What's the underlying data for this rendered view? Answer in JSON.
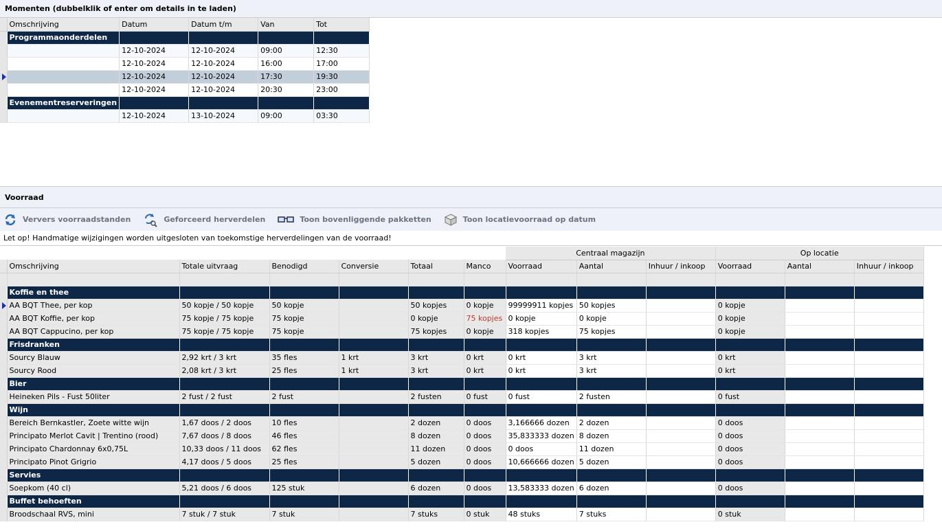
{
  "momenten": {
    "title": "Momenten (dubbelklik of enter om details in te laden)",
    "columns": [
      "Omschrijving",
      "Datum",
      "Datum t/m",
      "Van",
      "Tot"
    ],
    "groups": [
      {
        "name": "Programmaonderdelen",
        "rows": [
          {
            "omschrijving": "",
            "datum": "12-10-2024",
            "datum_tm": "12-10-2024",
            "van": "09:00",
            "tot": "12:30"
          },
          {
            "omschrijving": "",
            "datum": "12-10-2024",
            "datum_tm": "12-10-2024",
            "van": "16:00",
            "tot": "17:00"
          },
          {
            "omschrijving": "",
            "datum": "12-10-2024",
            "datum_tm": "12-10-2024",
            "van": "17:30",
            "tot": "19:30",
            "selected": true
          },
          {
            "omschrijving": "",
            "datum": "12-10-2024",
            "datum_tm": "12-10-2024",
            "van": "20:30",
            "tot": "23:00"
          }
        ]
      },
      {
        "name": "Evenementreserveringen",
        "rows": [
          {
            "omschrijving": "",
            "datum": "12-10-2024",
            "datum_tm": "13-10-2024",
            "van": "09:00",
            "tot": "03:30"
          }
        ]
      }
    ]
  },
  "voorraad": {
    "title": "Voorraad",
    "toolbar": {
      "refresh_label": "Ververs voorraadstanden",
      "force_label": "Geforceerd herverdelen",
      "packages_label": "Toon bovenliggende pakketten",
      "location_label": "Toon locatievoorraad op datum"
    },
    "warning": "Let op! Handmatige wijzigingen worden uitgesloten van toekomstige herverdelingen van de voorraad!",
    "supergroups": {
      "central": "Centraal magazijn",
      "location": "Op locatie"
    },
    "columns": [
      "Omschrijving",
      "Totale uitvraag",
      "Benodigd",
      "Conversie",
      "Totaal",
      "Manco",
      "Voorraad",
      "Aantal",
      "Inhuur / inkoop",
      "Voorraad",
      "Aantal",
      "Inhuur / inkoop"
    ],
    "groups": [
      {
        "name": "Koffie en thee",
        "rows": [
          [
            "AA BQT Thee, per kop",
            "50 kopje / 50 kopje",
            "50 kopje",
            "",
            "50 kopjes",
            "0 kopje",
            "99999911 kopjes",
            "50 kopjes",
            "",
            "0 kopje",
            "",
            ""
          ],
          [
            "AA BQT Koffie, per kop",
            "75 kopje / 75 kopje",
            "75 kopje",
            "",
            "0 kopje",
            "75 kopjes",
            "0 kopje",
            "0 kopje",
            "",
            "0 kopje",
            "",
            ""
          ],
          [
            "AA BQT Cappucino, per kop",
            "75 kopje / 75 kopje",
            "75 kopje",
            "",
            "75 kopjes",
            "0 kopje",
            "318 kopjes",
            "75 kopjes",
            "",
            "0 kopje",
            "",
            ""
          ]
        ]
      },
      {
        "name": "Frisdranken",
        "rows": [
          [
            "Sourcy Blauw",
            "2,92 krt / 3 krt",
            "35 fles",
            "1 krt",
            "3 krt",
            "0 krt",
            "0 krt",
            "3 krt",
            "",
            "0 krt",
            "",
            ""
          ],
          [
            "Sourcy Rood",
            "2,08 krt / 3 krt",
            "25 fles",
            "1 krt",
            "3 krt",
            "0 krt",
            "0 krt",
            "3 krt",
            "",
            "0 krt",
            "",
            ""
          ]
        ]
      },
      {
        "name": "Bier",
        "rows": [
          [
            "Heineken Pils - Fust 50liter",
            "2 fust / 2 fust",
            "2 fust",
            "",
            "2 fusten",
            "0 fust",
            "0 fust",
            "2 fusten",
            "",
            "0 fust",
            "",
            ""
          ]
        ]
      },
      {
        "name": "Wijn",
        "rows": [
          [
            "Bereich Bernkastler, Zoete witte wijn",
            "1,67 doos / 2 doos",
            "10 fles",
            "",
            "2 dozen",
            "0 doos",
            "3,166666 dozen",
            "2 dozen",
            "",
            "0 doos",
            "",
            ""
          ],
          [
            "Principato Merlot Cavit | Trentino (rood)",
            "7,67 doos / 8 doos",
            "46 fles",
            "",
            "8 dozen",
            "0 doos",
            "35,833333 dozen",
            "8 dozen",
            "",
            "0 doos",
            "",
            ""
          ],
          [
            "Principato Chardonnay 6x0,75L",
            "10,33 doos / 11 doos",
            "62 fles",
            "",
            "11 dozen",
            "0 doos",
            "0 doos",
            "11 dozen",
            "",
            "0 doos",
            "",
            ""
          ],
          [
            "Principato Pinot Grigrio",
            "4,17 doos / 5 doos",
            "25 fles",
            "",
            "5 dozen",
            "0 doos",
            "10,666666 dozen",
            "5 dozen",
            "",
            "0 doos",
            "",
            ""
          ]
        ]
      },
      {
        "name": "Servies",
        "rows": [
          [
            "Soepkom (40 cl)",
            "5,21 doos / 6 doos",
            "125 stuk",
            "",
            "6 dozen",
            "0 doos",
            "13,583333 dozen",
            "6 dozen",
            "",
            "0 doos",
            "",
            ""
          ]
        ]
      },
      {
        "name": "Buffet behoeften",
        "rows": [
          [
            "Broodschaal RVS, mini",
            "7 stuk / 7 stuk",
            "7 stuk",
            "",
            "7 stuks",
            "0 stuk",
            "48 stuks",
            "7 stuks",
            "",
            "0 stuk",
            "",
            ""
          ]
        ]
      }
    ],
    "selected_row": "AA BQT Thee, per kop",
    "manco_alert": "75 kopjes"
  },
  "colors": {
    "group_bg": "#0f2746",
    "selected_row": "#c3cedb",
    "manco_red": "#c0392b",
    "arrow": "#1a2fb8"
  },
  "icons": {
    "refresh": "refresh-icon",
    "force": "force-redistribute-icon",
    "packages": "glasses-icon",
    "location": "box-icon"
  }
}
